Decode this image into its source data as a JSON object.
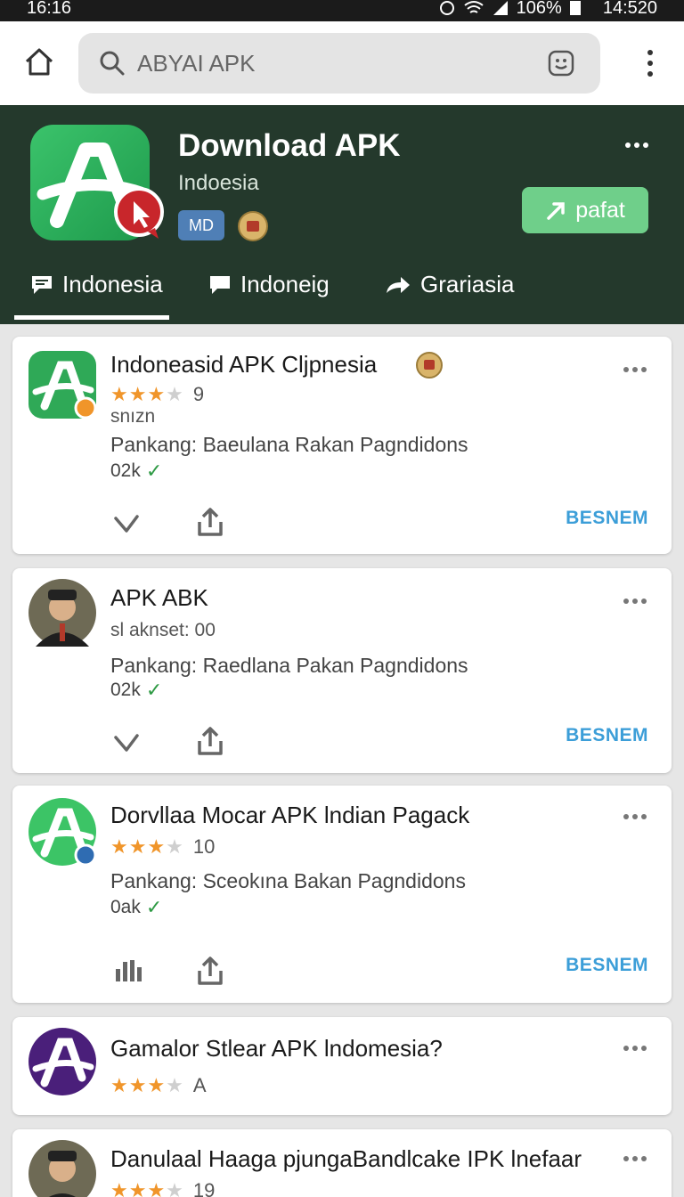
{
  "status_bar": {
    "time": "16:16",
    "battery": "106%",
    "clock_right": "14:520"
  },
  "search": {
    "placeholder": "ABYAI APK"
  },
  "header": {
    "title": "Download APK",
    "subtitle": "Indoesia",
    "badge": "MD",
    "update_label": "pafat",
    "tabs": [
      {
        "label": "Indonesia"
      },
      {
        "label": "Indoneig"
      },
      {
        "label": "Grariasia"
      }
    ]
  },
  "items": [
    {
      "title": "Indoneasid APK Cljpnesia",
      "rating_count": "9",
      "meta": "snızn",
      "description": "Pankang: Baeulana Rakan Pagndidons",
      "size": "02k",
      "install_label": "BESNEM"
    },
    {
      "title": "APK ABK",
      "meta": "sl aknset: 00",
      "description": "Pankang: Raedlana Pakan Pagndidons",
      "size": "02k",
      "install_label": "BESNEM"
    },
    {
      "title": "Dorvllaa Mocar APK lndian Pagack",
      "rating_count": "10",
      "description": "Pankang: Sceokına Bakan Pagndidons",
      "size": "0ak",
      "install_label": "BESNEM"
    },
    {
      "title": "Gamalor Stlear APK lndomesia?",
      "rating_count": "A"
    },
    {
      "title": "Danulaal Haaga pjungaBandlcake IPK lnefaar",
      "rating_count": "19"
    }
  ],
  "colors": {
    "header_bg": "#24392c",
    "accent_green": "#6fcf8a",
    "install_blue": "#3c9ed8",
    "star_orange": "#f0952a"
  }
}
